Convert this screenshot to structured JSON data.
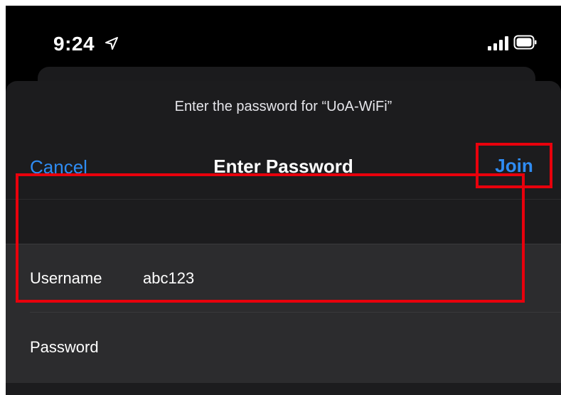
{
  "status_bar": {
    "time": "9:24",
    "icons": [
      "location-arrow-icon",
      "signal-bars-icon",
      "battery-icon"
    ]
  },
  "sheet": {
    "prompt": "Enter the password for “UoA-WiFi”",
    "nav": {
      "cancel_label": "Cancel",
      "title": "Enter Password",
      "join_label": "Join"
    },
    "fields": [
      {
        "label": "Username",
        "value": "abc123"
      },
      {
        "label": "Password",
        "value": ""
      }
    ]
  },
  "colors": {
    "accent": "#2f8cf3",
    "highlight": "#e8000c",
    "sheet_background": "#1c1c1e",
    "field_background": "#2c2c2e"
  }
}
